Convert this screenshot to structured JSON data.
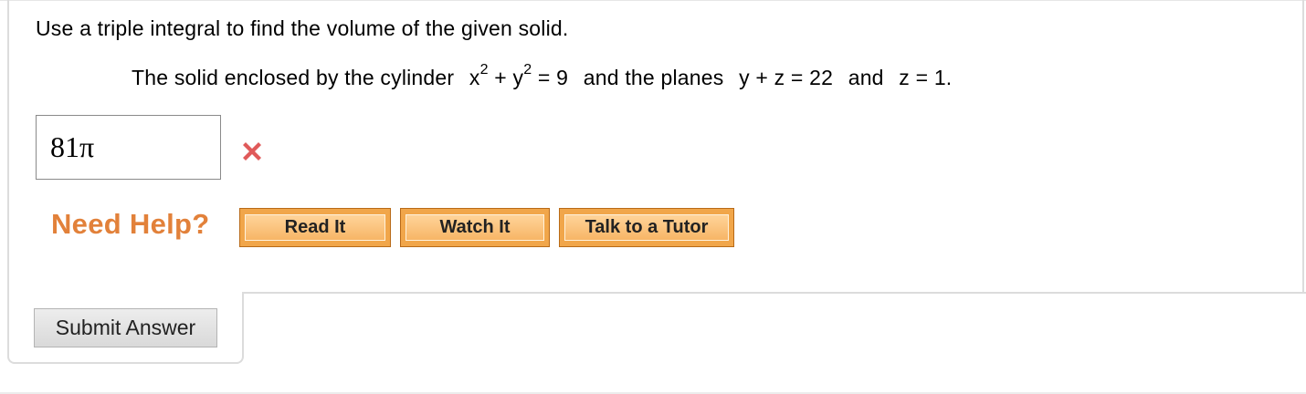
{
  "question": {
    "prompt": "Use a triple integral to find the volume of the given solid.",
    "statement": {
      "part1": "The solid enclosed by the cylinder",
      "x": "x",
      "sq1": "2",
      "plus1": "+",
      "y": "y",
      "sq2": "2",
      "eq1": "=",
      "nine": "9",
      "part2": "and the planes",
      "plane1_y": "y",
      "plus2": "+",
      "plane1_z": "z",
      "eq2": "=",
      "val22": "22",
      "and": "and",
      "plane2_z": "z",
      "eq3": "=",
      "val1": "1."
    }
  },
  "answer": {
    "value": "81π",
    "status_icon": "incorrect-x-icon",
    "status_color": "#e05a5a"
  },
  "help": {
    "label": "Need Help?",
    "buttons": [
      "Read It",
      "Watch It",
      "Talk to a Tutor"
    ],
    "accent_color": "#e2813a"
  },
  "submit": {
    "label": "Submit Answer"
  }
}
